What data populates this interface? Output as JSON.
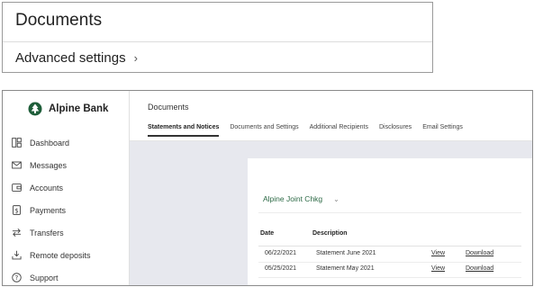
{
  "callout": {
    "title": "Documents",
    "advanced_settings": "Advanced settings",
    "chevron": "›"
  },
  "brand": {
    "name": "Alpine Bank",
    "color": "#1f5e3a"
  },
  "sidebar": {
    "items": [
      {
        "label": "Dashboard",
        "icon": "dashboard-icon"
      },
      {
        "label": "Messages",
        "icon": "envelope-icon"
      },
      {
        "label": "Accounts",
        "icon": "wallet-icon"
      },
      {
        "label": "Payments",
        "icon": "dollar-icon"
      },
      {
        "label": "Transfers",
        "icon": "transfer-icon"
      },
      {
        "label": "Remote deposits",
        "icon": "deposit-icon"
      },
      {
        "label": "Support",
        "icon": "help-icon"
      }
    ]
  },
  "header": {
    "title": "Documents",
    "tabs": [
      {
        "label": "Statements and Notices",
        "active": true
      },
      {
        "label": "Documents and Settings",
        "active": false
      },
      {
        "label": "Additional Recipients",
        "active": false
      },
      {
        "label": "Disclosures",
        "active": false
      },
      {
        "label": "Email Settings",
        "active": false
      }
    ]
  },
  "statements": {
    "account_selector": "Alpine Joint Chkg",
    "account_chevron": "⌄",
    "columns": {
      "date": "Date",
      "description": "Description"
    },
    "rows": [
      {
        "date": "06/22/2021",
        "description": "Statement June 2021",
        "view": "View",
        "download": "Download"
      },
      {
        "date": "05/25/2021",
        "description": "Statement May 2021",
        "view": "View",
        "download": "Download"
      }
    ]
  },
  "colors": {
    "accent": "#2e6b47",
    "content_bg": "#e7e8ee"
  }
}
